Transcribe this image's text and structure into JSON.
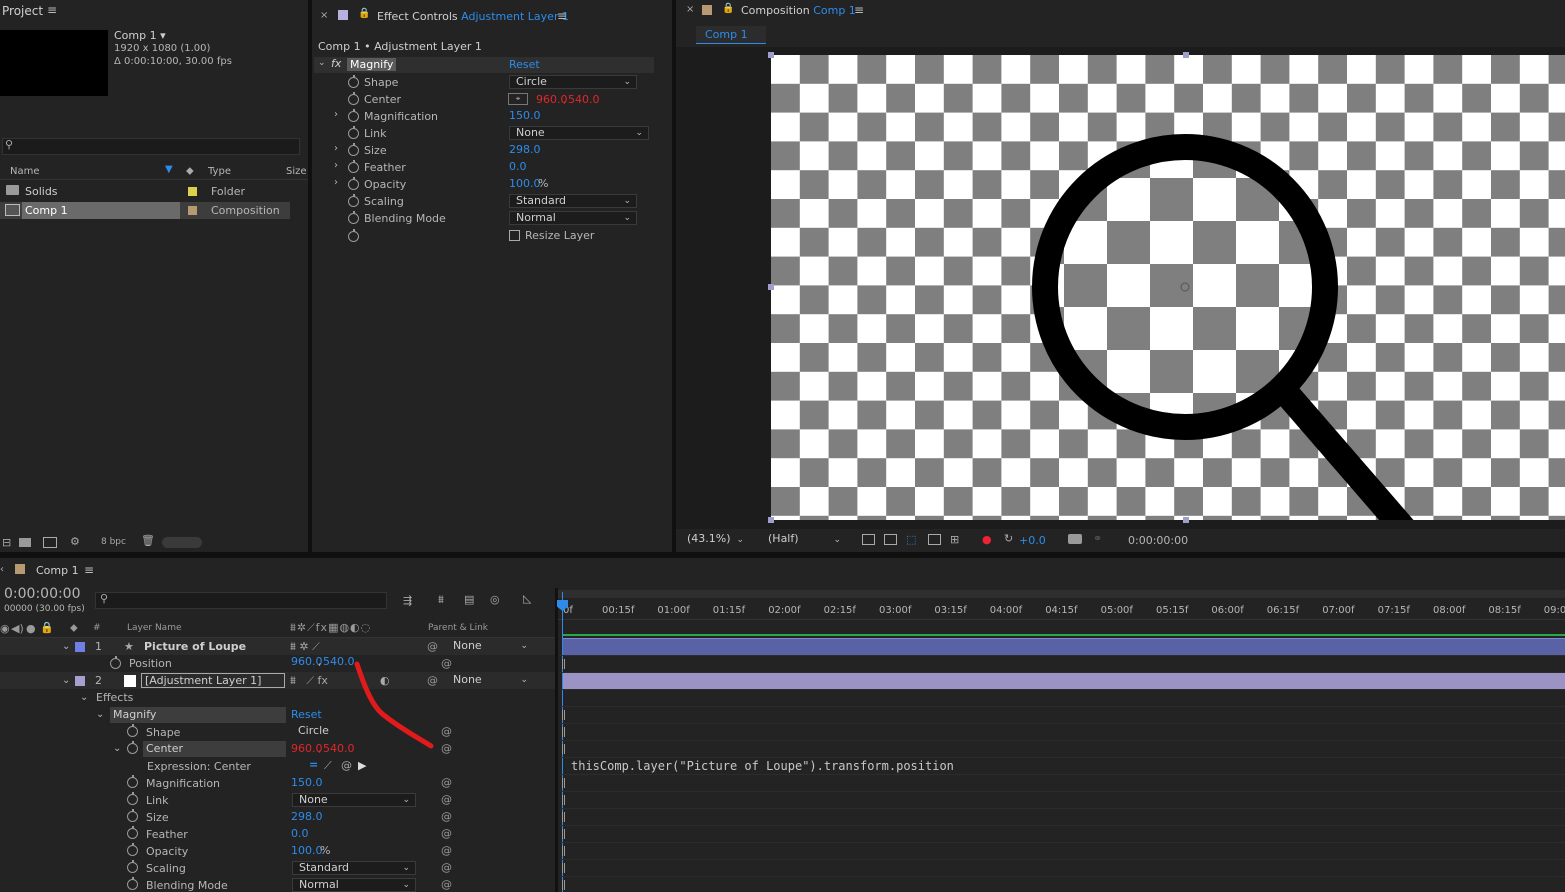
{
  "project": {
    "panel_title": "Project",
    "comp_name": "Comp 1 ▾",
    "comp_res": "1920 x 1080 (1.00)",
    "comp_dur": "Δ 0:00:10:00, 30.00 fps",
    "columns": {
      "name": "Name",
      "type": "Type",
      "size": "Size"
    },
    "items": [
      {
        "name": "Solids",
        "type": "Folder",
        "color": "#d9d24a"
      },
      {
        "name": "Comp 1",
        "type": "Composition",
        "color": "#b89a72"
      }
    ],
    "bpc": "8 bpc"
  },
  "effect_controls": {
    "panel_title": "Effect Controls",
    "layer": "Adjustment Layer 1",
    "breadcrumb": "Comp 1 • Adjustment Layer 1",
    "effect_name": "Magnify",
    "reset": "Reset",
    "props": {
      "shape": {
        "label": "Shape",
        "value": "Circle"
      },
      "center": {
        "label": "Center",
        "x": "960.0",
        "y": "540.0"
      },
      "magnification": {
        "label": "Magnification",
        "value": "150.0"
      },
      "link": {
        "label": "Link",
        "value": "None"
      },
      "size": {
        "label": "Size",
        "value": "298.0"
      },
      "feather": {
        "label": "Feather",
        "value": "0.0"
      },
      "opacity": {
        "label": "Opacity",
        "value": "100.0",
        "unit": "%"
      },
      "scaling": {
        "label": "Scaling",
        "value": "Standard"
      },
      "blending": {
        "label": "Blending Mode",
        "value": "Normal"
      },
      "resize": {
        "label": "Resize Layer"
      }
    }
  },
  "composition": {
    "panel_title": "Composition",
    "comp": "Comp 1",
    "tab": "Comp 1",
    "zoom": "(43.1%)",
    "resolution": "(Half)",
    "exposure": "+0.0",
    "timecode": "0:00:00:00"
  },
  "timeline": {
    "panel_title": "Comp 1",
    "timecode": "0:00:00:00",
    "frames": "00000 (30.00 fps)",
    "col_layer_name": "Layer Name",
    "col_parent": "Parent & Link",
    "col_num": "#",
    "ruler": [
      "00:15f",
      "01:00f",
      "01:15f",
      "02:00f",
      "02:15f",
      "03:00f",
      "03:15f",
      "04:00f",
      "04:15f",
      "05:00f",
      "05:15f",
      "06:00f",
      "06:15f",
      "07:00f",
      "07:15f",
      "08:00f",
      "08:15f",
      "09:0"
    ],
    "ruler_start": "0f",
    "layers": [
      {
        "num": "1",
        "name": "Picture of Loupe",
        "parent": "None",
        "color": "#6f7fe6"
      },
      {
        "num": "2",
        "name": "[Adjustment Layer 1]",
        "parent": "None",
        "color": "#a99fcf"
      }
    ],
    "position": {
      "label": "Position",
      "x": "960.0",
      "y": "540.0"
    },
    "effects_label": "Effects",
    "magnify": {
      "label": "Magnify",
      "reset": "Reset"
    },
    "props": {
      "shape": {
        "label": "Shape",
        "value": "Circle"
      },
      "center": {
        "label": "Center",
        "x": "960.0",
        "y": "540.0"
      },
      "expression_label": "Expression: Center",
      "magnification": {
        "label": "Magnification",
        "value": "150.0"
      },
      "link": {
        "label": "Link",
        "value": "None"
      },
      "size": {
        "label": "Size",
        "value": "298.0"
      },
      "feather": {
        "label": "Feather",
        "value": "0.0"
      },
      "opacity": {
        "label": "Opacity",
        "value": "100.0",
        "unit": "%"
      },
      "scaling": {
        "label": "Scaling",
        "value": "Standard"
      },
      "blending": {
        "label": "Blending Mode",
        "value": "Normal"
      }
    },
    "expression_text": "thisComp.layer(\"Picture of Loupe\").transform.position"
  },
  "icons": [
    "menu-icon",
    "search-icon",
    "stopwatch-icon",
    "lock-icon",
    "eye-icon",
    "audio-icon",
    "solo-icon",
    "label-icon",
    "twirl-icon",
    "pickwhip-icon",
    "star-icon",
    "camera-icon",
    "trash-icon",
    "folder-icon",
    "composition-icon"
  ],
  "colors": {
    "accent": "#2d8ceb",
    "value_red": "#e3262a",
    "panel_bg": "#232323",
    "annotation": "#e11b1b"
  }
}
